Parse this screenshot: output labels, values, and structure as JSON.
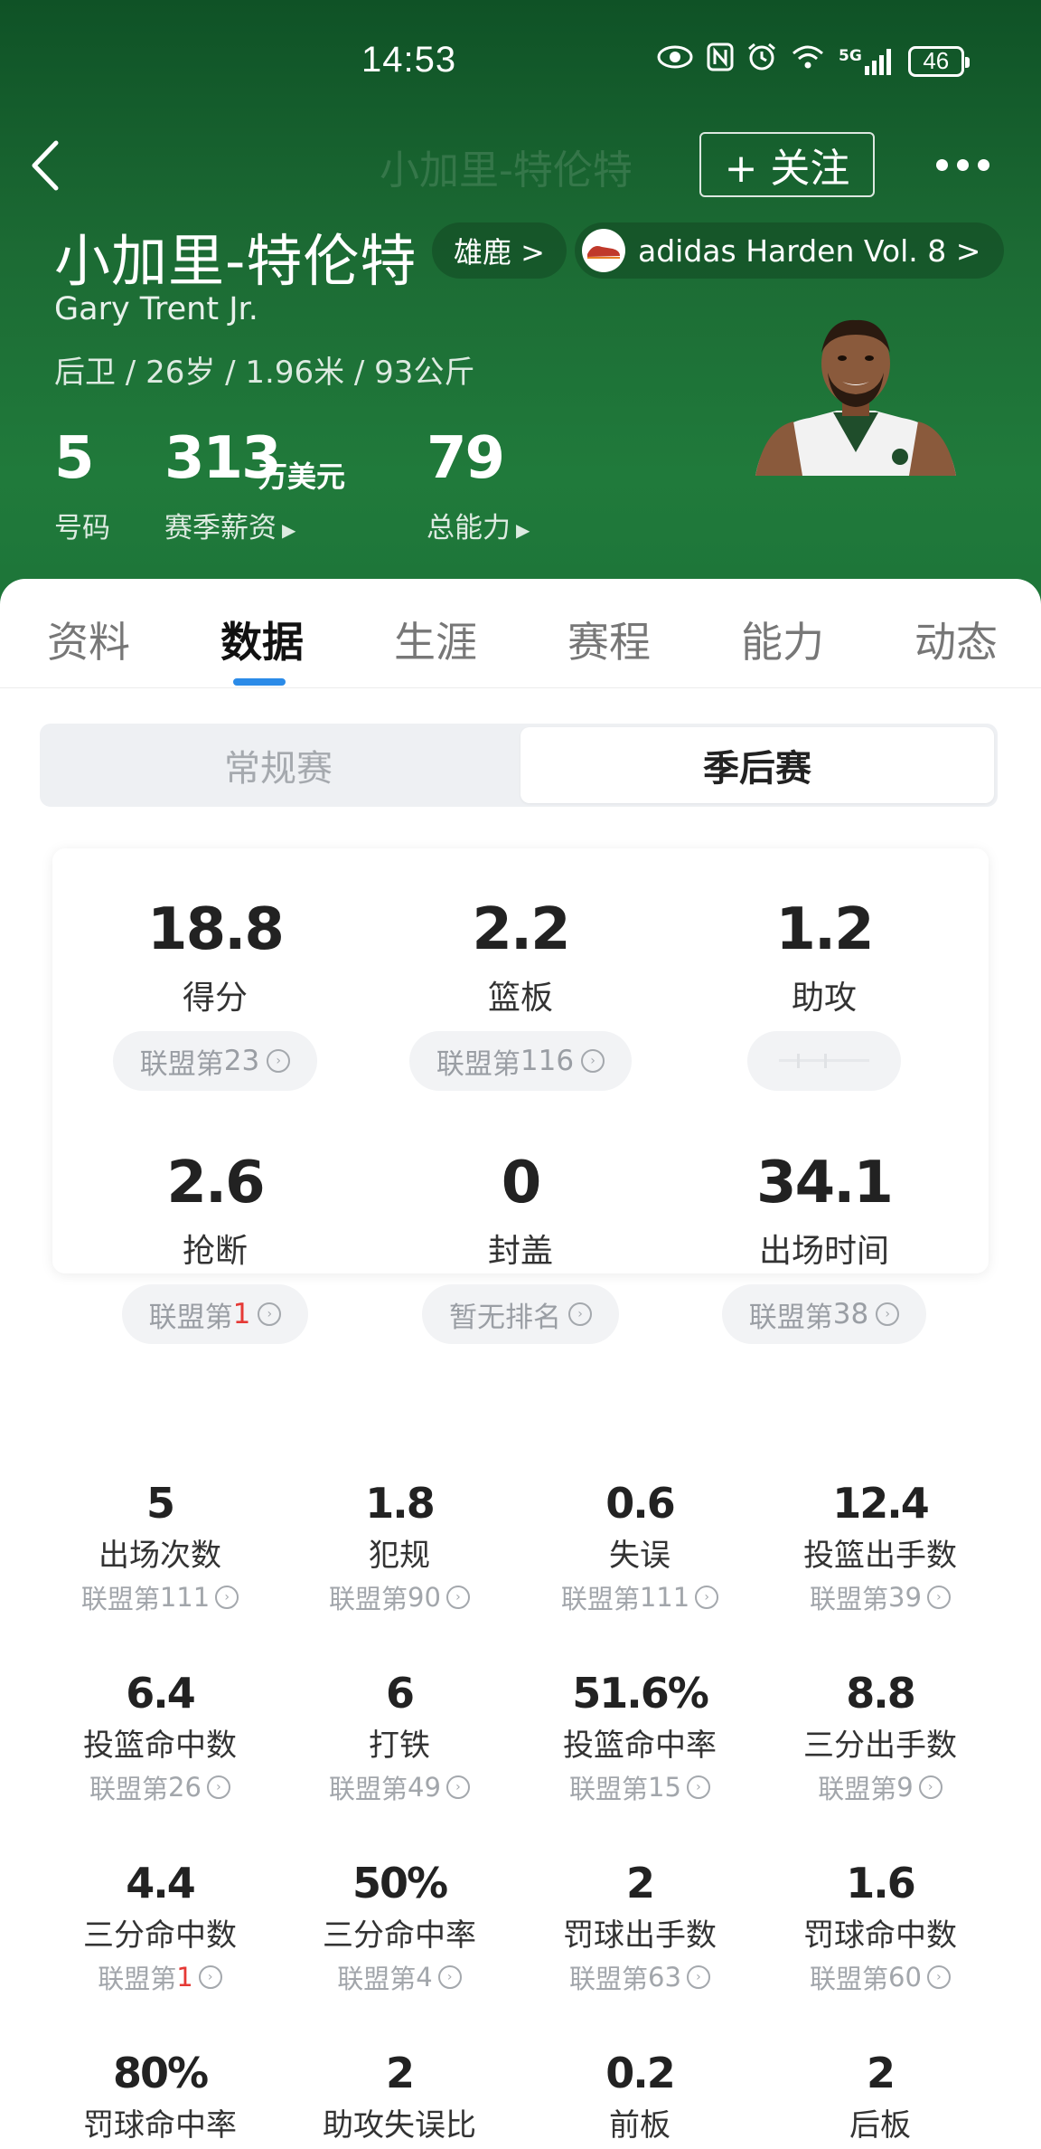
{
  "status_bar": {
    "time": "14:53",
    "battery": "46",
    "net": "5G"
  },
  "nav": {
    "title": "小加里-特伦特",
    "follow_label": "+ 关注"
  },
  "player": {
    "name_cn": "小加里-特伦特",
    "name_en": "Gary Trent Jr.",
    "team_chip": "雄鹿 >",
    "shoe_chip": "adidas Harden Vol. 8 >",
    "meta": "后卫 / 26岁 / 1.96米 / 93公斤",
    "number_value": "5",
    "number_label": "号码",
    "salary_value": "313",
    "salary_unit": "万美元",
    "salary_label": "赛季薪资",
    "ability_value": "79",
    "ability_label": "总能力"
  },
  "tabs": [
    {
      "label": "资料"
    },
    {
      "label": "数据",
      "active": true
    },
    {
      "label": "生涯"
    },
    {
      "label": "赛程"
    },
    {
      "label": "能力"
    },
    {
      "label": "动态"
    }
  ],
  "segment": {
    "left": "常规赛",
    "right": "季后赛",
    "selected": "季后赛"
  },
  "main_stats": [
    {
      "value": "18.8",
      "label": "得分",
      "rank_prefix": "联盟第",
      "rank": "23"
    },
    {
      "value": "2.2",
      "label": "篮板",
      "rank_prefix": "联盟第",
      "rank": "116"
    },
    {
      "value": "1.2",
      "label": "助攻",
      "rank_prefix": "",
      "rank": ""
    },
    {
      "value": "2.6",
      "label": "抢断",
      "rank_prefix": "联盟第",
      "rank": "1"
    },
    {
      "value": "0",
      "label": "封盖",
      "rank_prefix": "暂无排名",
      "rank": ""
    },
    {
      "value": "34.1",
      "label": "出场时间",
      "rank_prefix": "联盟第",
      "rank": "38"
    }
  ],
  "detail_stats": [
    {
      "value": "5",
      "label": "出场次数",
      "rank_prefix": "联盟第",
      "rank": "111"
    },
    {
      "value": "1.8",
      "label": "犯规",
      "rank_prefix": "联盟第",
      "rank": "90"
    },
    {
      "value": "0.6",
      "label": "失误",
      "rank_prefix": "联盟第",
      "rank": "111"
    },
    {
      "value": "12.4",
      "label": "投篮出手数",
      "rank_prefix": "联盟第",
      "rank": "39"
    },
    {
      "value": "6.4",
      "label": "投篮命中数",
      "rank_prefix": "联盟第",
      "rank": "26"
    },
    {
      "value": "6",
      "label": "打铁",
      "rank_prefix": "联盟第",
      "rank": "49"
    },
    {
      "value": "51.6%",
      "label": "投篮命中率",
      "rank_prefix": "联盟第",
      "rank": "15"
    },
    {
      "value": "8.8",
      "label": "三分出手数",
      "rank_prefix": "联盟第",
      "rank": "9"
    },
    {
      "value": "4.4",
      "label": "三分命中数",
      "rank_prefix": "联盟第",
      "rank": "1"
    },
    {
      "value": "50%",
      "label": "三分命中率",
      "rank_prefix": "联盟第",
      "rank": "4"
    },
    {
      "value": "2",
      "label": "罚球出手数",
      "rank_prefix": "联盟第",
      "rank": "63"
    },
    {
      "value": "1.6",
      "label": "罚球命中数",
      "rank_prefix": "联盟第",
      "rank": "60"
    },
    {
      "value": "80%",
      "label": "罚球命中率",
      "rank_prefix": "",
      "rank": ""
    },
    {
      "value": "2",
      "label": "助攻失误比",
      "rank_prefix": "",
      "rank": ""
    },
    {
      "value": "0.2",
      "label": "前板",
      "rank_prefix": "",
      "rank": ""
    },
    {
      "value": "2",
      "label": "后板",
      "rank_prefix": "",
      "rank": ""
    }
  ],
  "colors": {
    "header_green": "#1c6b34",
    "tab_underline": "#2b8be8",
    "rank_highlight": "#e53935"
  }
}
